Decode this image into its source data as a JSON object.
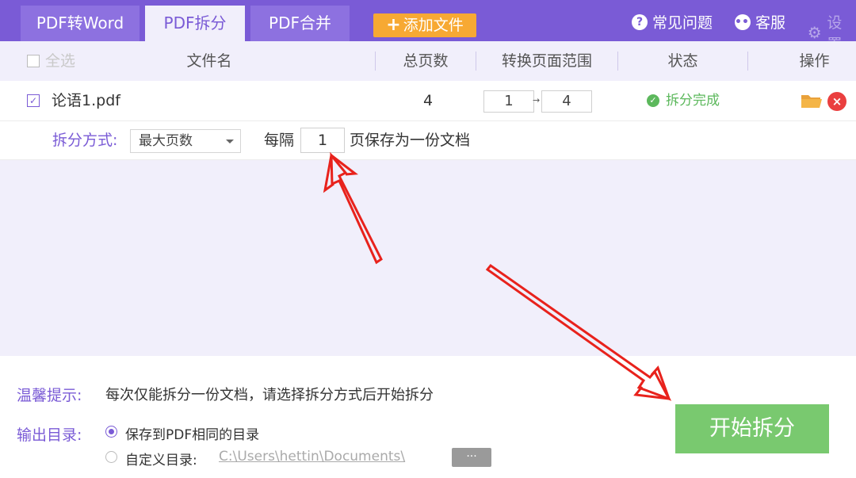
{
  "tabs": [
    {
      "label": "PDF转Word",
      "active": false
    },
    {
      "label": "PDF拆分",
      "active": true
    },
    {
      "label": "PDF合并",
      "active": false
    }
  ],
  "add_file": {
    "icon": "plus-icon",
    "label": "添加文件"
  },
  "top_links": {
    "faq": {
      "icon": "question-circle-icon",
      "label": "常见问题"
    },
    "service": {
      "icon": "chat-bubble-icon",
      "label": "客服"
    },
    "settings": {
      "icon": "gear-icon",
      "label": "设置"
    }
  },
  "table": {
    "select_all": "全选",
    "columns": {
      "filename": "文件名",
      "total_pages": "总页数",
      "range": "转换页面范围",
      "status": "状态",
      "actions": "操作"
    },
    "rows": [
      {
        "checked": true,
        "filename": "论语1.pdf",
        "total_pages": "4",
        "range_from": "1",
        "range_arrow": "→",
        "range_to": "4",
        "status": "拆分完成",
        "status_icon": "check-circle-icon",
        "actions": [
          "folder-open-icon",
          "close-circle-icon"
        ]
      }
    ]
  },
  "split": {
    "label": "拆分方式:",
    "mode_selected": "最大页数",
    "every_label": "每隔",
    "every_value": "1",
    "every_suffix": "页保存为一份文档"
  },
  "footer": {
    "tip_label": "温馨提示:",
    "tip_text": "每次仅能拆分一份文档，请选择拆分方式后开始拆分",
    "output_label": "输出目录:",
    "option_same": "保存到PDF相同的目录",
    "option_custom": "自定义目录:",
    "custom_path": "C:\\Users\\hettin\\Documents\\",
    "browse": "···",
    "start": "开始拆分"
  },
  "colors": {
    "brand": "#7a5bd6",
    "add_button": "#f7a933",
    "start_button": "#79c96f",
    "success": "#5cb85c",
    "delete": "#ea3f3f",
    "annotation_arrow": "#e8221c"
  }
}
